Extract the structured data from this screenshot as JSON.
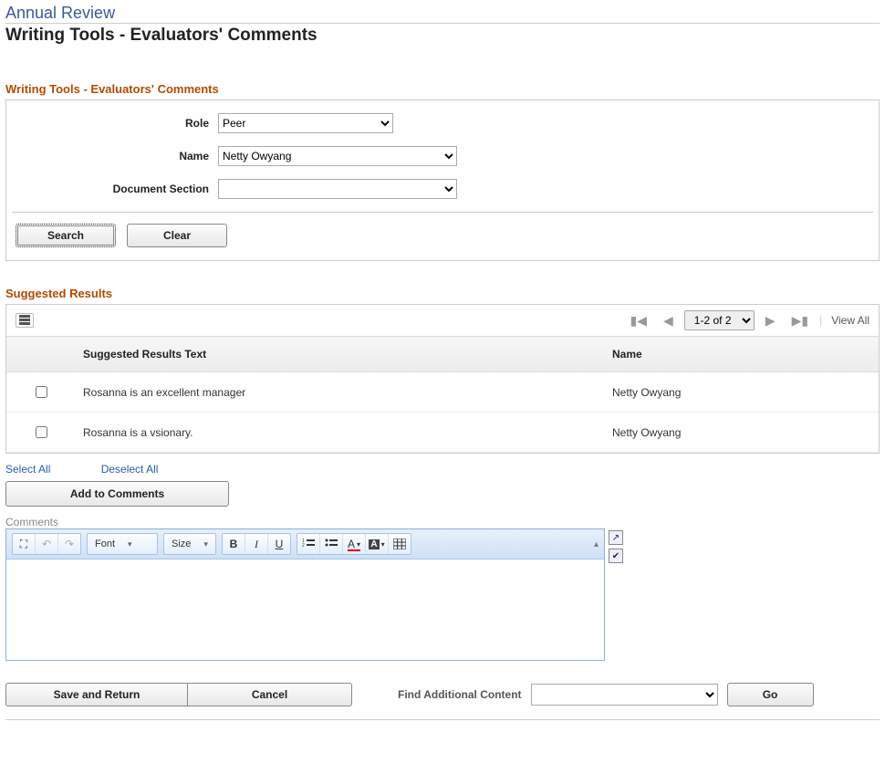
{
  "breadcrumb": "Annual Review",
  "page_title": "Writing Tools - Evaluators' Comments",
  "filter": {
    "header": "Writing Tools - Evaluators' Comments",
    "role_label": "Role",
    "role_value": "Peer",
    "name_label": "Name",
    "name_value": "Netty Owyang",
    "section_label": "Document Section",
    "section_value": "",
    "search_label": "Search",
    "clear_label": "Clear"
  },
  "results": {
    "header": "Suggested Results",
    "pager": "1-2 of 2",
    "view_all": "View All",
    "col_text": "Suggested Results Text",
    "col_name": "Name",
    "rows": [
      {
        "text": "Rosanna is an excellent manager",
        "name": "Netty Owyang"
      },
      {
        "text": "Rosanna is a vsionary.",
        "name": "Netty Owyang"
      }
    ],
    "select_all": "Select All",
    "deselect_all": "Deselect All",
    "add_to_comments": "Add to Comments"
  },
  "comments": {
    "label": "Comments",
    "font_label": "Font",
    "size_label": "Size"
  },
  "footer": {
    "save": "Save and Return",
    "cancel": "Cancel",
    "find_label": "Find Additional Content",
    "go": "Go"
  }
}
